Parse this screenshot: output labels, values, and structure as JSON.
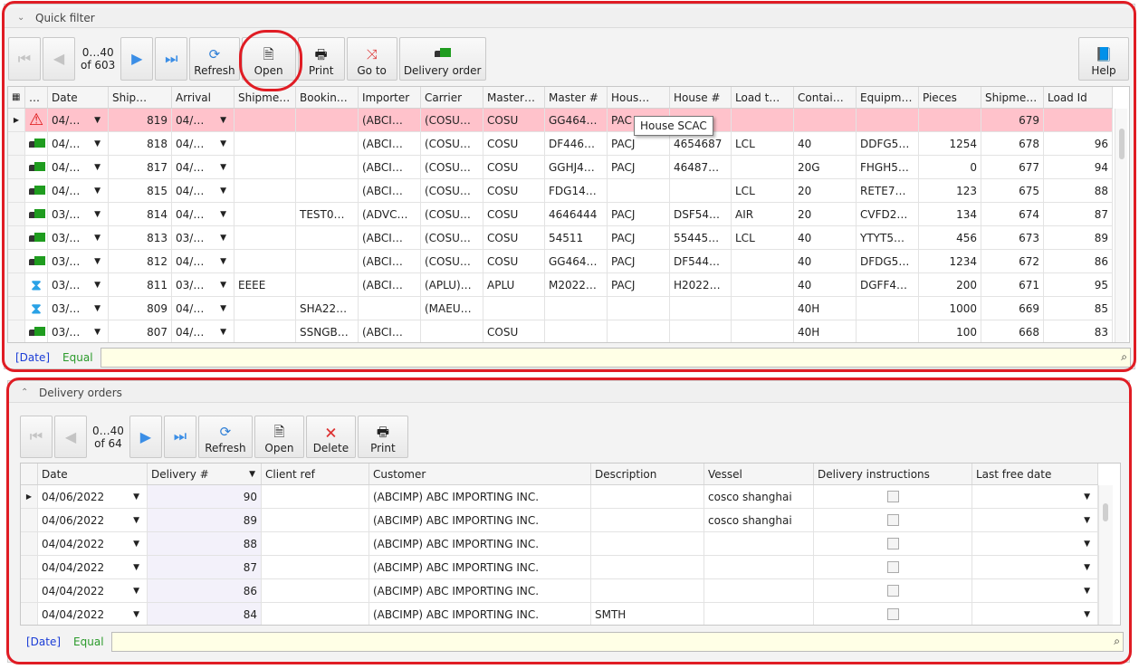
{
  "top": {
    "title": "Quick filter",
    "pager": {
      "range": "0…40",
      "total": "of 603"
    },
    "buttons": {
      "refresh": "Refresh",
      "open": "Open",
      "print": "Print",
      "goto": "Go to",
      "delivery": "Delivery order",
      "help": "Help"
    },
    "columns": [
      "…",
      "Date",
      "Ship…",
      "Arrival",
      "Shipme…",
      "Bookin…",
      "Importer",
      "Carrier",
      "Master…",
      "Master #",
      "Hous…",
      "House #",
      "Load t…",
      "Contai…",
      "Equipm…",
      "Pieces",
      "Shipme…",
      "Load Id"
    ],
    "rows": [
      {
        "icon": "warning",
        "date": "04/…",
        "ship": "819",
        "arrival": "04/…",
        "shipme": "",
        "booking": "",
        "importer": "(ABCI…",
        "carrier": "(COSU…",
        "mscac": "COSU",
        "master": "GG464…",
        "house_scac": "PAC",
        "house": "…",
        "load": "",
        "cont": "",
        "equip": "",
        "pieces": "",
        "shipno": "679",
        "loadid": ""
      },
      {
        "icon": "truck",
        "date": "04/…",
        "ship": "818",
        "arrival": "04/…",
        "shipme": "",
        "booking": "",
        "importer": "(ABCI…",
        "carrier": "(COSU…",
        "mscac": "COSU",
        "master": "DF446…",
        "house_scac": "PACJ",
        "house": "4654687",
        "load": "LCL",
        "cont": "40",
        "equip": "DDFG5…",
        "pieces": "1254",
        "shipno": "678",
        "loadid": "96"
      },
      {
        "icon": "truck",
        "date": "04/…",
        "ship": "817",
        "arrival": "04/…",
        "shipme": "",
        "booking": "",
        "importer": "(ABCI…",
        "carrier": "(COSU…",
        "mscac": "COSU",
        "master": "GGHJ4…",
        "house_scac": "PACJ",
        "house": "46487…",
        "load": "",
        "cont": "20G",
        "equip": "FHGH5…",
        "pieces": "0",
        "shipno": "677",
        "loadid": "94"
      },
      {
        "icon": "truck",
        "date": "04/…",
        "ship": "815",
        "arrival": "04/…",
        "shipme": "",
        "booking": "",
        "importer": "(ABCI…",
        "carrier": "(COSU…",
        "mscac": "COSU",
        "master": "FDG14…",
        "house_scac": "",
        "house": "",
        "load": "LCL",
        "cont": "20",
        "equip": "RETE7…",
        "pieces": "123",
        "shipno": "675",
        "loadid": "88"
      },
      {
        "icon": "truck",
        "date": "03/…",
        "ship": "814",
        "arrival": "04/…",
        "shipme": "",
        "booking": "TEST0…",
        "importer": "(ADVC…",
        "carrier": "(COSU…",
        "mscac": "COSU",
        "master": "4646444",
        "house_scac": "PACJ",
        "house": "DSF54…",
        "load": "AIR",
        "cont": "20",
        "equip": "CVFD2…",
        "pieces": "134",
        "shipno": "674",
        "loadid": "87"
      },
      {
        "icon": "truck",
        "date": "03/…",
        "ship": "813",
        "arrival": "03/…",
        "shipme": "",
        "booking": "",
        "importer": "(ABCI…",
        "carrier": "(COSU…",
        "mscac": "COSU",
        "master": "54511",
        "house_scac": "PACJ",
        "house": "55445…",
        "load": "LCL",
        "cont": "40",
        "equip": "YTYT5…",
        "pieces": "456",
        "shipno": "673",
        "loadid": "89"
      },
      {
        "icon": "truck",
        "date": "03/…",
        "ship": "812",
        "arrival": "04/…",
        "shipme": "",
        "booking": "",
        "importer": "(ABCI…",
        "carrier": "(COSU…",
        "mscac": "COSU",
        "master": "GG464…",
        "house_scac": "PACJ",
        "house": "DF544…",
        "load": "",
        "cont": "40",
        "equip": "DFDG5…",
        "pieces": "1234",
        "shipno": "672",
        "loadid": "86"
      },
      {
        "icon": "hourglass",
        "date": "03/…",
        "ship": "811",
        "arrival": "03/…",
        "shipme": "EEEE",
        "booking": "",
        "importer": "(ABCI…",
        "carrier": "(APLU)…",
        "mscac": "APLU",
        "master": "M2022…",
        "house_scac": "PACJ",
        "house": "H2022…",
        "load": "",
        "cont": "40",
        "equip": "DGFF4…",
        "pieces": "200",
        "shipno": "671",
        "loadid": "95"
      },
      {
        "icon": "hourglass",
        "date": "03/…",
        "ship": "809",
        "arrival": "04/…",
        "shipme": "",
        "booking": "SHA22…",
        "importer": "",
        "carrier": "(MAEU…",
        "mscac": "",
        "master": "",
        "house_scac": "",
        "house": "",
        "load": "",
        "cont": "40H",
        "equip": "",
        "pieces": "1000",
        "shipno": "669",
        "loadid": "85"
      },
      {
        "icon": "truck",
        "date": "03/…",
        "ship": "807",
        "arrival": "04/…",
        "shipme": "",
        "booking": "SSNGB…",
        "importer": "(ABCI…",
        "carrier": "",
        "mscac": "COSU",
        "master": "",
        "house_scac": "",
        "house": "",
        "load": "",
        "cont": "40H",
        "equip": "",
        "pieces": "100",
        "shipno": "668",
        "loadid": "83"
      }
    ],
    "tooltip": "House SCAC",
    "filter": {
      "field": "[Date]",
      "op": "Equal",
      "value": ""
    }
  },
  "bottom": {
    "title": "Delivery orders",
    "pager": {
      "range": "0…40",
      "total": "of 64"
    },
    "buttons": {
      "refresh": "Refresh",
      "open": "Open",
      "delete": "Delete",
      "print": "Print"
    },
    "columns": [
      "Date",
      "Delivery #",
      "Client ref",
      "Customer",
      "Description",
      "Vessel",
      "Delivery instructions",
      "Last free date"
    ],
    "rows": [
      {
        "date": "04/06/2022",
        "no": "90",
        "client": "",
        "customer": "(ABCIMP) ABC IMPORTING INC.",
        "desc": "",
        "vessel": "cosco shanghai",
        "instr": false,
        "lfd": ""
      },
      {
        "date": "04/06/2022",
        "no": "89",
        "client": "",
        "customer": "(ABCIMP) ABC IMPORTING INC.",
        "desc": "",
        "vessel": "cosco shanghai",
        "instr": false,
        "lfd": ""
      },
      {
        "date": "04/04/2022",
        "no": "88",
        "client": "",
        "customer": "(ABCIMP) ABC IMPORTING INC.",
        "desc": "",
        "vessel": "",
        "instr": false,
        "lfd": ""
      },
      {
        "date": "04/04/2022",
        "no": "87",
        "client": "",
        "customer": "(ABCIMP) ABC IMPORTING INC.",
        "desc": "",
        "vessel": "",
        "instr": false,
        "lfd": ""
      },
      {
        "date": "04/04/2022",
        "no": "86",
        "client": "",
        "customer": "(ABCIMP) ABC IMPORTING INC.",
        "desc": "",
        "vessel": "",
        "instr": false,
        "lfd": ""
      },
      {
        "date": "04/04/2022",
        "no": "84",
        "client": "",
        "customer": "(ABCIMP) ABC IMPORTING INC.",
        "desc": "SMTH",
        "vessel": "",
        "instr": false,
        "lfd": ""
      }
    ],
    "filter": {
      "field": "[Date]",
      "op": "Equal",
      "value": ""
    }
  },
  "colors": {
    "selected_row": "#ffc2cb",
    "annotation": "#e01c24",
    "filter_bg": "#ffffe6"
  }
}
